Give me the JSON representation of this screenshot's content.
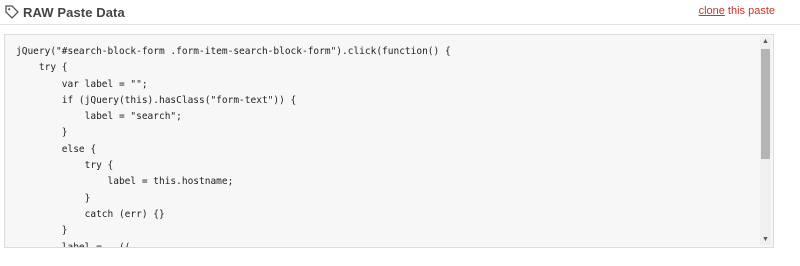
{
  "header": {
    "title": "RAW Paste Data",
    "icon": "tag-icon",
    "clone_link": "clone",
    "clone_suffix": " this paste",
    "link_color": "#c0392b"
  },
  "code": {
    "lines": [
      "jQuery(\"#search-block-form .form-item-search-block-form\").click(function() {",
      "    try {",
      "        var label = \"\";",
      "        if (jQuery(this).hasClass(\"form-text\")) {",
      "            label = \"search\";",
      "        }",
      "        else {",
      "            try {",
      "                label = this.hostname;",
      "            }",
      "            catch (err) {}",
      "        }",
      "        label = ..(("
    ]
  },
  "scrollbar": {
    "up_icon": "up-arrow-icon",
    "down_icon": "down-arrow-icon"
  }
}
